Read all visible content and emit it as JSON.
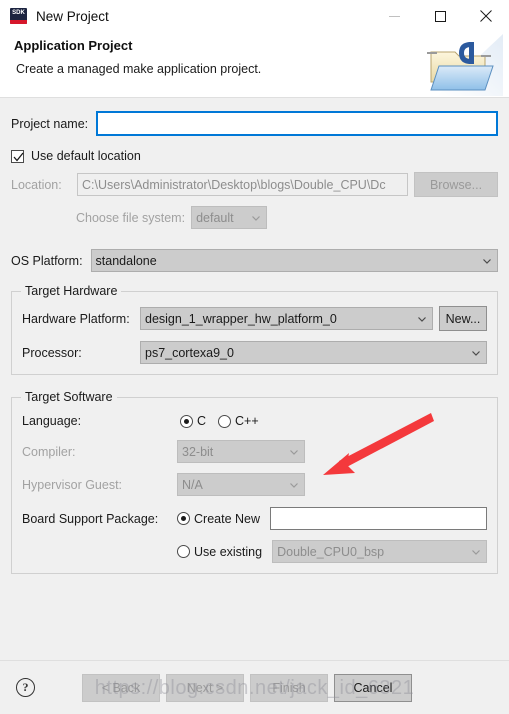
{
  "window": {
    "title": "New Project",
    "app_icon_label": "SDK",
    "controls": {
      "minimize": "minimize-icon",
      "maximize": "maximize-icon",
      "close": "close-icon"
    }
  },
  "banner": {
    "title": "Application Project",
    "subtitle": "Create a managed make application project.",
    "art": "folder-c-icon"
  },
  "form": {
    "project_name": {
      "label": "Project name:",
      "value": "",
      "placeholder": ""
    },
    "use_default_location": {
      "label": "Use default location",
      "checked": true
    },
    "location": {
      "label": "Location:",
      "value": "C:\\Users\\Administrator\\Desktop\\blogs\\Double_CPU\\Dc",
      "browse_label": "Browse..."
    },
    "file_system": {
      "label": "Choose file system:",
      "value": "default"
    },
    "os_platform": {
      "label": "OS Platform:",
      "value": "standalone"
    }
  },
  "target_hardware": {
    "title": "Target Hardware",
    "hardware_platform": {
      "label": "Hardware Platform:",
      "value": "design_1_wrapper_hw_platform_0",
      "new_label": "New..."
    },
    "processor": {
      "label": "Processor:",
      "value": "ps7_cortexa9_0"
    }
  },
  "target_software": {
    "title": "Target Software",
    "language": {
      "label": "Language:",
      "options": [
        "C",
        "C++"
      ],
      "selected": "C"
    },
    "compiler": {
      "label": "Compiler:",
      "value": "32-bit"
    },
    "hypervisor_guest": {
      "label": "Hypervisor Guest:",
      "value": "N/A"
    },
    "bsp": {
      "label": "Board Support Package:",
      "create_new_label": "Create New",
      "create_new_value": "",
      "use_existing_label": "Use existing",
      "use_existing_value": "Double_CPU0_bsp",
      "selected": "Create New"
    }
  },
  "footer": {
    "help_label": "?",
    "back_label": "< Back",
    "next_label": "Next >",
    "finish_label": "Finish",
    "cancel_label": "Cancel"
  },
  "watermark": {
    "text": "https://blog.csdn.net/jack_id_6321"
  },
  "annotation": {
    "arrow": "red-arrow-pointer",
    "color": "#f4393c"
  },
  "colors": {
    "focus_border": "#0078d7",
    "window_bg": "#f0f0f0",
    "accent_red": "#d6172b",
    "annotation_red": "#f4393c"
  }
}
